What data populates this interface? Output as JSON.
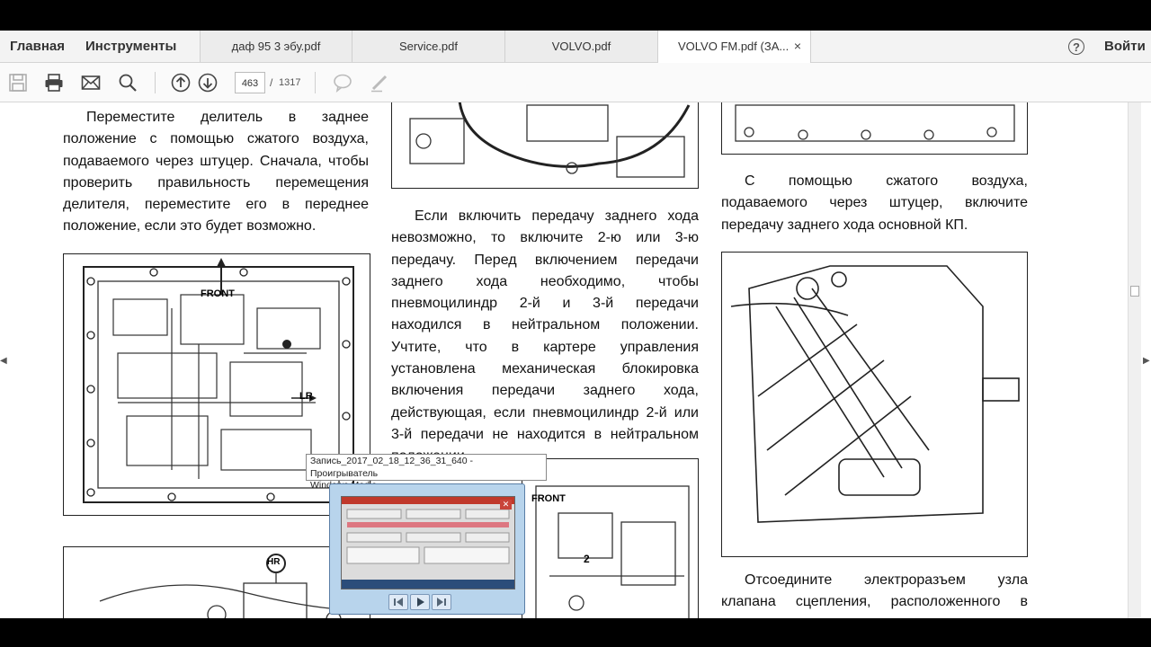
{
  "menu": {
    "home": "Главная",
    "tools": "Инструменты"
  },
  "tabs": [
    {
      "label": "даф 95 3 эбу.pdf"
    },
    {
      "label": "Service.pdf"
    },
    {
      "label": "VOLVO.pdf"
    },
    {
      "label": "VOLVO FM.pdf (ЗА...",
      "close": "×"
    }
  ],
  "account": {
    "help": "?",
    "login": "Войти"
  },
  "toolbar": {
    "current_page": "463",
    "separator": "/",
    "total_pages": "1317"
  },
  "document": {
    "col1_text": "Переместите делитель в заднее положение с помощью сжатого воздуха, подаваемого через штуцер. Сначала, чтобы проверить правильность перемещения делителя, переместите его в переднее положение, если это будет возможно.",
    "col2_text": "Если включить передачу заднего хода невозможно, то включите 2-ю или 3-ю передачу. Перед включением передачи заднего хода необходимо, чтобы пневмоцилиндр 2-й и 3-й передачи находился в нейтральном положении. Учтите, что в картере управления установлена механическая блокировка включения передачи заднего хода, действующая, если пневмоцилиндр 2-й или 3-й передачи не находится в нейтральном положении.",
    "col3_text": "С помощью сжатого воздуха, подаваемого через штуцер, включите передачу заднего хода основной КП.",
    "col3_text2": "Отсоедините электроразъем узла клапана сцепления, расположенного в картере",
    "fig1_labels": {
      "front": "FRONT",
      "lr": "LR"
    },
    "fig2_labels": {
      "hr": "HR"
    },
    "fig3_labels": {
      "front": "FRONT",
      "num": "2"
    }
  },
  "tooltip": {
    "line1": "Запись_2017_02_18_12_36_31_640 - Проигрыватель",
    "line2": "Windows Media"
  },
  "icons": [
    "save-icon",
    "print-icon",
    "mail-icon",
    "search-icon",
    "page-up-icon",
    "page-down-icon",
    "comment-icon",
    "pen-icon"
  ]
}
